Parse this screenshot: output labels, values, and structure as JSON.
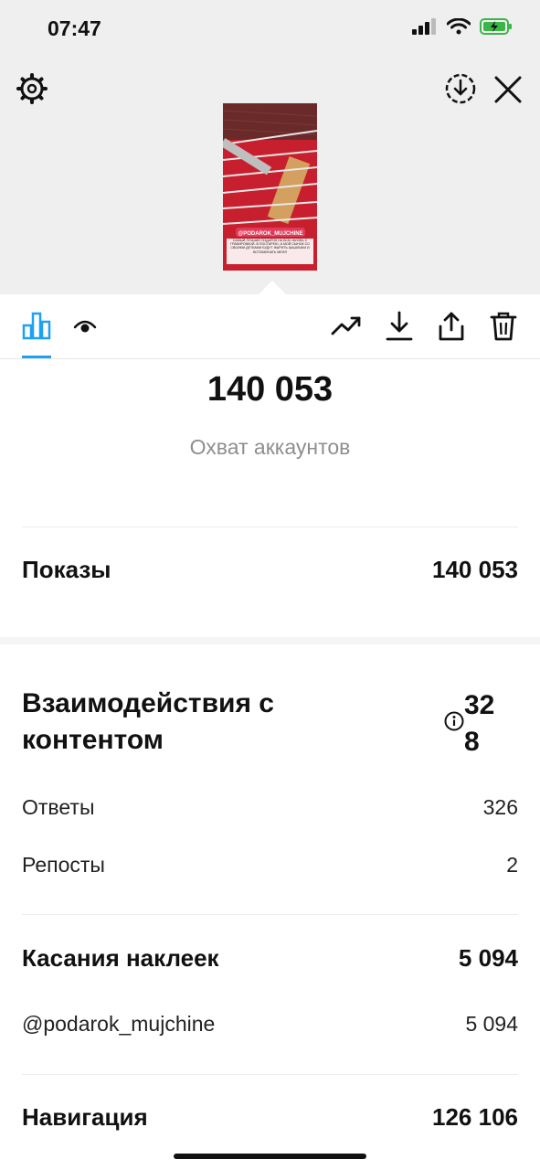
{
  "status_bar": {
    "time": "07:47",
    "icons": [
      "signal-icon",
      "wifi-icon",
      "battery-charging-icon"
    ]
  },
  "header": {
    "left_icon": "settings-gear-icon",
    "right_icons": [
      "download-icon",
      "close-icon"
    ]
  },
  "story_preview": {
    "tag": "@PODAROK_MUJCHINE",
    "caption": "САМЫЙ ЛУЧШИЙ ПОДАРОК НА ВСЮ ЖИЗНЬ С ГРАВИРОВКОЙ. В ПОСТАРЕЮ, А МОЙ СЫНОК СО СВОИМИ ДЕТКАМИ БУДУТ ЖАРИТЬ ШАШЛЫКИ И ВСПОМИНАТЬ МЕНЯ"
  },
  "toolbar": {
    "tabs": [
      "insights-bar-chart-icon",
      "viewers-eye-icon"
    ],
    "active_tab": "insights-bar-chart-icon",
    "actions": [
      "promote-trend-icon",
      "save-download-icon",
      "share-icon",
      "delete-trash-icon"
    ]
  },
  "summary": {
    "reach_value": "140 053",
    "reach_label": "Охват аккаунтов"
  },
  "impressions": {
    "label": "Показы",
    "value": "140 053"
  },
  "interactions": {
    "label": "Взаимодействия с контентом",
    "value": "328",
    "rows": [
      {
        "label": "Ответы",
        "value": "326"
      },
      {
        "label": "Репосты",
        "value": "2"
      }
    ]
  },
  "sticker_taps": {
    "label": "Касания наклеек",
    "value": "5 094",
    "rows": [
      {
        "label": "@podarok_mujchine",
        "value": "5 094"
      }
    ]
  },
  "navigation": {
    "label": "Навигация",
    "value": "126 106"
  },
  "colors": {
    "accent": "#1da1f2",
    "top_background": "#efefef",
    "muted_text": "#8e8e8e",
    "story_red": "#c81f2e"
  }
}
